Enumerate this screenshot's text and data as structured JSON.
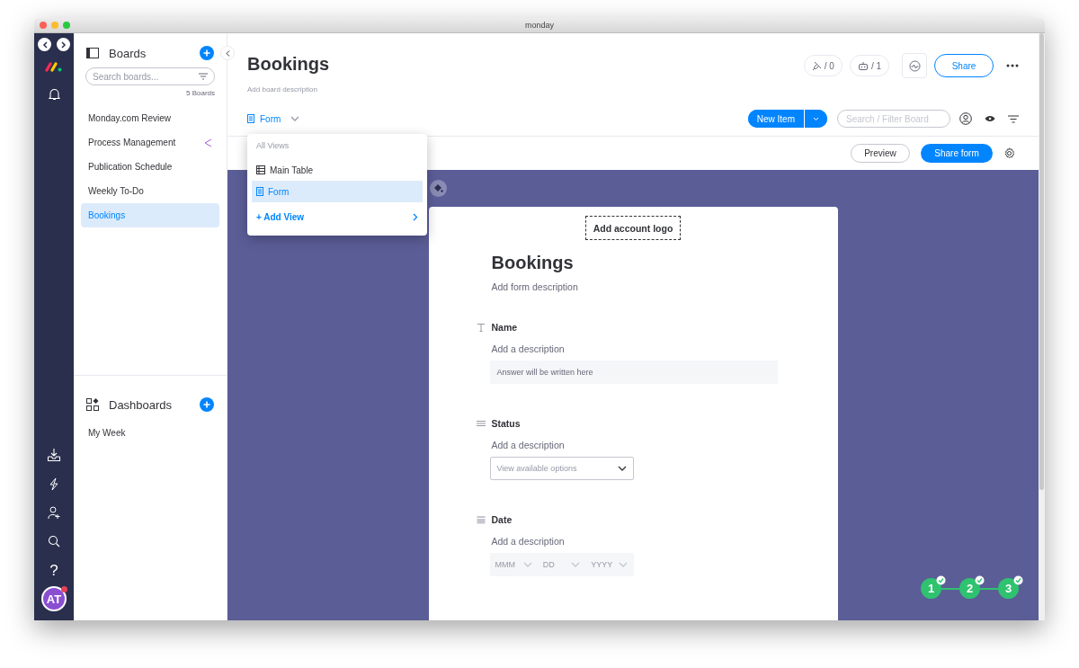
{
  "window": {
    "title": "monday"
  },
  "rail": {
    "help": "?",
    "avatar": "AT",
    "notification": true
  },
  "sidebar": {
    "boards_title": "Boards",
    "search_placeholder": "Search boards...",
    "count": "5 Boards",
    "boards": [
      {
        "label": "Monday.com Review",
        "selected": false,
        "shared": false
      },
      {
        "label": "Process Management",
        "selected": false,
        "shared": true
      },
      {
        "label": "Publication Schedule",
        "selected": false,
        "shared": false
      },
      {
        "label": "Weekly To-Do",
        "selected": false,
        "shared": false
      },
      {
        "label": "Bookings",
        "selected": true,
        "shared": false
      }
    ],
    "dashboards_title": "Dashboards",
    "dashboards": [
      {
        "label": "My Week",
        "selected": false
      }
    ]
  },
  "board": {
    "title": "Bookings",
    "description": "Add board description",
    "view": "Form",
    "counters": [
      {
        "kind": "integrations",
        "label": "/ 0"
      },
      {
        "kind": "automations",
        "label": "/ 1"
      }
    ],
    "share": "Share",
    "new_item": "New Item",
    "search_placeholder": "Search / Filter Board"
  },
  "views_menu": {
    "heading": "All Views",
    "items": [
      {
        "kind": "table",
        "label": "Main Table",
        "selected": false
      },
      {
        "kind": "form",
        "label": "Form",
        "selected": true
      }
    ],
    "add": "+ Add View"
  },
  "form_toolbar": {
    "preview": "Preview",
    "share_form": "Share form"
  },
  "form": {
    "logo": "Add account logo",
    "title": "Bookings",
    "description": "Add form description",
    "questions": [
      {
        "kind": "text",
        "label": "Name",
        "description": "Add a description",
        "placeholder": "Answer will be written here"
      },
      {
        "kind": "status",
        "label": "Status",
        "description": "Add a description",
        "placeholder": "View available options"
      },
      {
        "kind": "date",
        "label": "Date",
        "description": "Add a description",
        "parts": [
          "MMM",
          "DD",
          "YYYY"
        ]
      }
    ]
  },
  "steps": [
    {
      "label": "1",
      "done": true
    },
    {
      "label": "2",
      "done": true
    },
    {
      "label": "3",
      "done": true
    }
  ]
}
